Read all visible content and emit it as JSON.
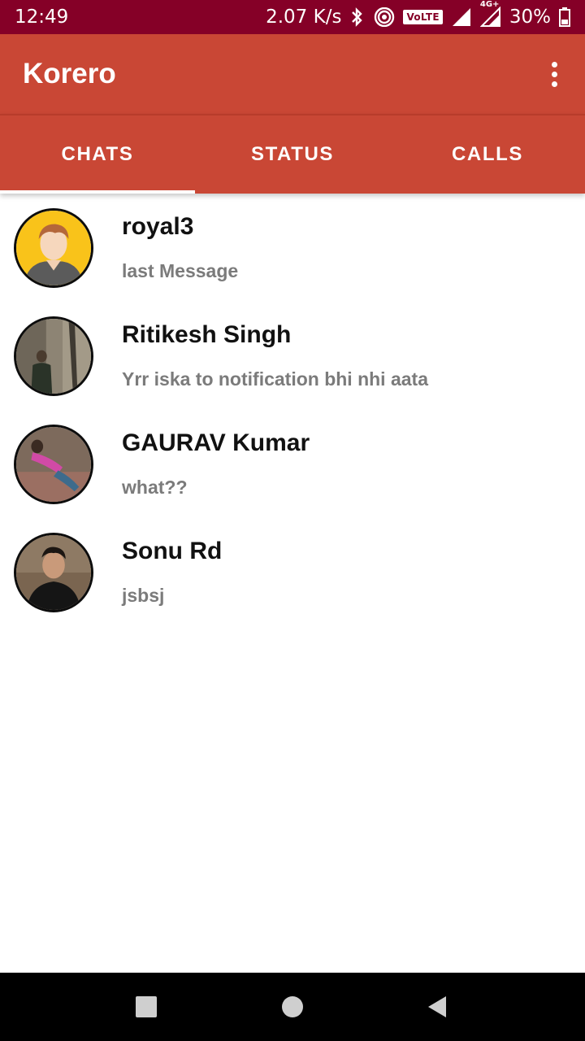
{
  "status_bar": {
    "time": "12:49",
    "speed": "2.07 K/s",
    "volte_label": "VoLTE",
    "network_label": "4G+",
    "battery": "30%"
  },
  "app_bar": {
    "title": "Korero",
    "menu_icon": "more-vert-icon"
  },
  "tabs": [
    {
      "label": "CHATS",
      "active": true
    },
    {
      "label": "STATUS",
      "active": false
    },
    {
      "label": "CALLS",
      "active": false
    }
  ],
  "chats": [
    {
      "name": "royal3",
      "last_message": "last Message",
      "avatar": "default-avatar"
    },
    {
      "name": "Ritikesh Singh",
      "last_message": "Yrr iska to notification bhi nhi aata",
      "avatar": "photo-avatar"
    },
    {
      "name": "GAURAV Kumar",
      "last_message": "what??",
      "avatar": "photo-avatar"
    },
    {
      "name": "Sonu Rd",
      "last_message": "jsbsj",
      "avatar": "photo-avatar"
    }
  ],
  "nav_bar": {
    "recents_icon": "square-icon",
    "home_icon": "circle-icon",
    "back_icon": "triangle-back-icon"
  },
  "colors": {
    "status_bar": "#850027",
    "primary": "#c94735",
    "name_text": "#111111",
    "message_text": "#7b7b7b"
  }
}
